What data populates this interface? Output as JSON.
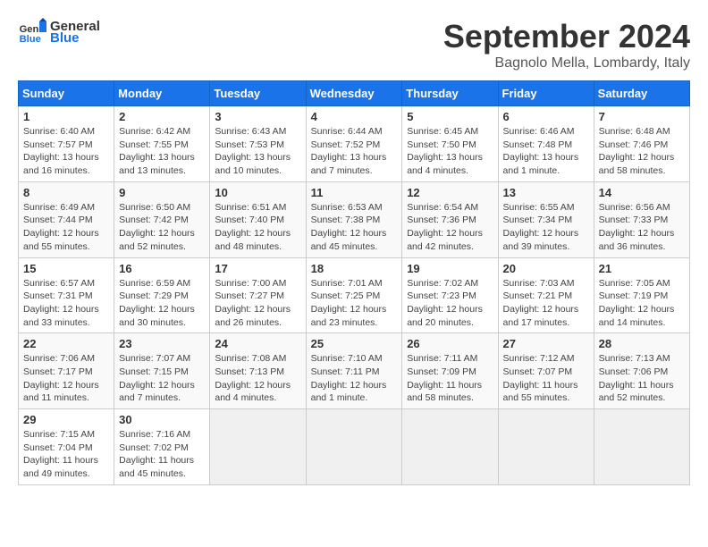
{
  "header": {
    "logo_general": "General",
    "logo_blue": "Blue",
    "month_title": "September 2024",
    "location": "Bagnolo Mella, Lombardy, Italy"
  },
  "weekdays": [
    "Sunday",
    "Monday",
    "Tuesday",
    "Wednesday",
    "Thursday",
    "Friday",
    "Saturday"
  ],
  "weeks": [
    [
      {
        "day": "1",
        "sunrise": "6:40 AM",
        "sunset": "7:57 PM",
        "daylight": "13 hours and 16 minutes."
      },
      {
        "day": "2",
        "sunrise": "6:42 AM",
        "sunset": "7:55 PM",
        "daylight": "13 hours and 13 minutes."
      },
      {
        "day": "3",
        "sunrise": "6:43 AM",
        "sunset": "7:53 PM",
        "daylight": "13 hours and 10 minutes."
      },
      {
        "day": "4",
        "sunrise": "6:44 AM",
        "sunset": "7:52 PM",
        "daylight": "13 hours and 7 minutes."
      },
      {
        "day": "5",
        "sunrise": "6:45 AM",
        "sunset": "7:50 PM",
        "daylight": "13 hours and 4 minutes."
      },
      {
        "day": "6",
        "sunrise": "6:46 AM",
        "sunset": "7:48 PM",
        "daylight": "13 hours and 1 minute."
      },
      {
        "day": "7",
        "sunrise": "6:48 AM",
        "sunset": "7:46 PM",
        "daylight": "12 hours and 58 minutes."
      }
    ],
    [
      {
        "day": "8",
        "sunrise": "6:49 AM",
        "sunset": "7:44 PM",
        "daylight": "12 hours and 55 minutes."
      },
      {
        "day": "9",
        "sunrise": "6:50 AM",
        "sunset": "7:42 PM",
        "daylight": "12 hours and 52 minutes."
      },
      {
        "day": "10",
        "sunrise": "6:51 AM",
        "sunset": "7:40 PM",
        "daylight": "12 hours and 48 minutes."
      },
      {
        "day": "11",
        "sunrise": "6:53 AM",
        "sunset": "7:38 PM",
        "daylight": "12 hours and 45 minutes."
      },
      {
        "day": "12",
        "sunrise": "6:54 AM",
        "sunset": "7:36 PM",
        "daylight": "12 hours and 42 minutes."
      },
      {
        "day": "13",
        "sunrise": "6:55 AM",
        "sunset": "7:34 PM",
        "daylight": "12 hours and 39 minutes."
      },
      {
        "day": "14",
        "sunrise": "6:56 AM",
        "sunset": "7:33 PM",
        "daylight": "12 hours and 36 minutes."
      }
    ],
    [
      {
        "day": "15",
        "sunrise": "6:57 AM",
        "sunset": "7:31 PM",
        "daylight": "12 hours and 33 minutes."
      },
      {
        "day": "16",
        "sunrise": "6:59 AM",
        "sunset": "7:29 PM",
        "daylight": "12 hours and 30 minutes."
      },
      {
        "day": "17",
        "sunrise": "7:00 AM",
        "sunset": "7:27 PM",
        "daylight": "12 hours and 26 minutes."
      },
      {
        "day": "18",
        "sunrise": "7:01 AM",
        "sunset": "7:25 PM",
        "daylight": "12 hours and 23 minutes."
      },
      {
        "day": "19",
        "sunrise": "7:02 AM",
        "sunset": "7:23 PM",
        "daylight": "12 hours and 20 minutes."
      },
      {
        "day": "20",
        "sunrise": "7:03 AM",
        "sunset": "7:21 PM",
        "daylight": "12 hours and 17 minutes."
      },
      {
        "day": "21",
        "sunrise": "7:05 AM",
        "sunset": "7:19 PM",
        "daylight": "12 hours and 14 minutes."
      }
    ],
    [
      {
        "day": "22",
        "sunrise": "7:06 AM",
        "sunset": "7:17 PM",
        "daylight": "12 hours and 11 minutes."
      },
      {
        "day": "23",
        "sunrise": "7:07 AM",
        "sunset": "7:15 PM",
        "daylight": "12 hours and 7 minutes."
      },
      {
        "day": "24",
        "sunrise": "7:08 AM",
        "sunset": "7:13 PM",
        "daylight": "12 hours and 4 minutes."
      },
      {
        "day": "25",
        "sunrise": "7:10 AM",
        "sunset": "7:11 PM",
        "daylight": "12 hours and 1 minute."
      },
      {
        "day": "26",
        "sunrise": "7:11 AM",
        "sunset": "7:09 PM",
        "daylight": "11 hours and 58 minutes."
      },
      {
        "day": "27",
        "sunrise": "7:12 AM",
        "sunset": "7:07 PM",
        "daylight": "11 hours and 55 minutes."
      },
      {
        "day": "28",
        "sunrise": "7:13 AM",
        "sunset": "7:06 PM",
        "daylight": "11 hours and 52 minutes."
      }
    ],
    [
      {
        "day": "29",
        "sunrise": "7:15 AM",
        "sunset": "7:04 PM",
        "daylight": "11 hours and 49 minutes."
      },
      {
        "day": "30",
        "sunrise": "7:16 AM",
        "sunset": "7:02 PM",
        "daylight": "11 hours and 45 minutes."
      },
      null,
      null,
      null,
      null,
      null
    ]
  ],
  "labels": {
    "sunrise": "Sunrise:",
    "sunset": "Sunset:",
    "daylight": "Daylight:"
  }
}
